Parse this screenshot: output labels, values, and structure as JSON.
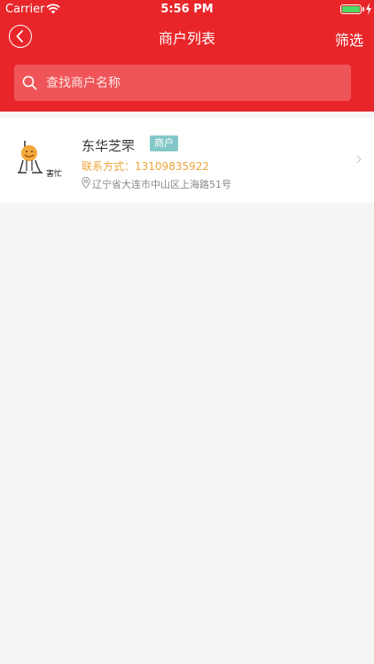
{
  "status_bar": {
    "carrier": "Carrier",
    "time": "5:56 PM"
  },
  "nav": {
    "title": "商户列表",
    "filter_label": "筛选"
  },
  "search": {
    "placeholder": "查找商户名称",
    "value": ""
  },
  "merchants": [
    {
      "name": "东华芝罘",
      "badge": "商户",
      "contact_label": "联系方式：",
      "phone": "13109835922",
      "address": "辽宁省大连市中山区上海路51号",
      "avatar_text": "害忙"
    }
  ],
  "colors": {
    "header_red": "#e8262a",
    "badge_teal": "#83c7c8",
    "contact_orange": "#f0a43a",
    "background": "#f5f5f5"
  }
}
